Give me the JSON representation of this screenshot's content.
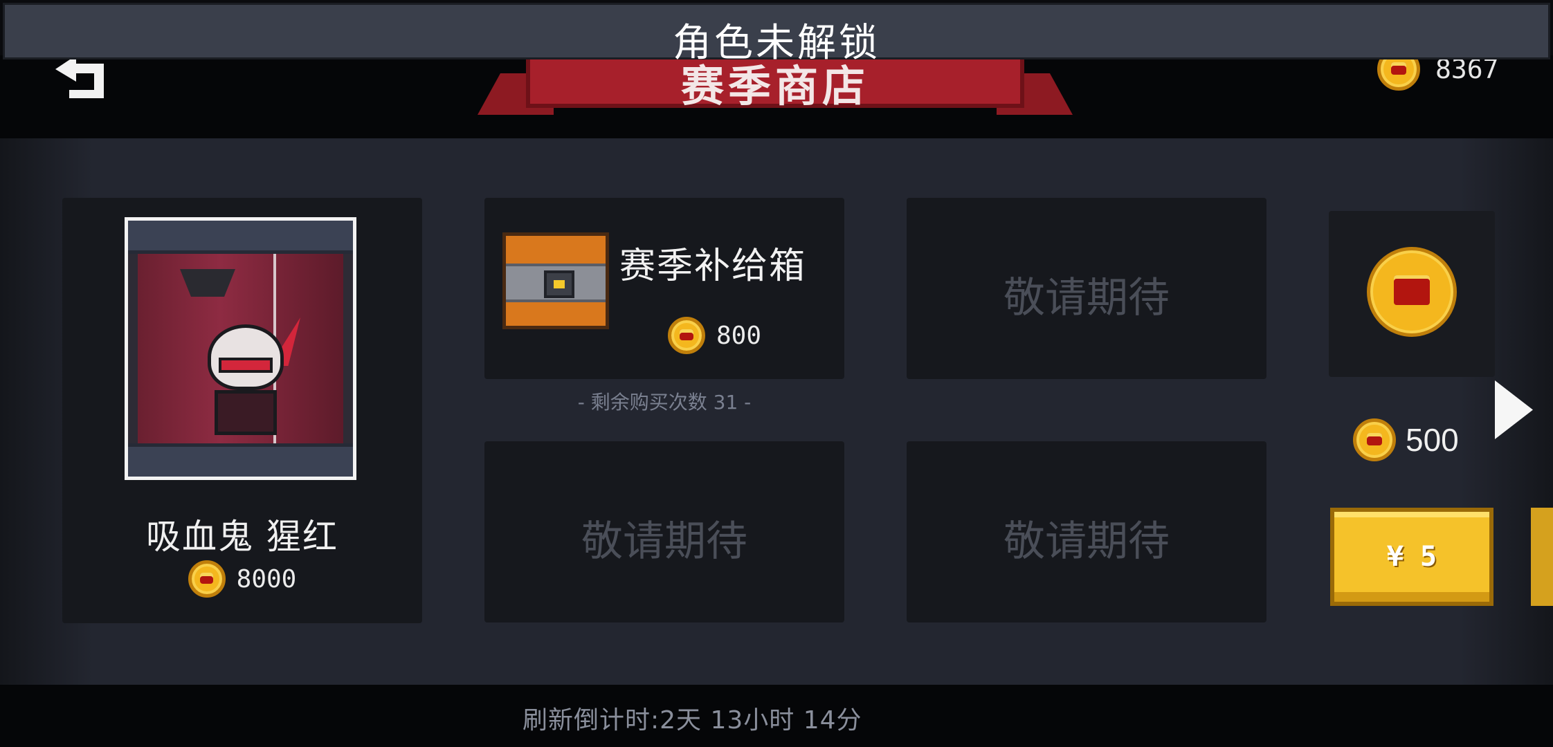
{
  "notice": {
    "text": "角色未解锁"
  },
  "header": {
    "title": "赛季商店",
    "currency_value": "8367"
  },
  "shop": {
    "character": {
      "name": "吸血鬼 猩红",
      "price": "8000"
    },
    "supply_box": {
      "title": "赛季补给箱",
      "price": "800",
      "remaining": "- 剩余购买次数 31 -"
    },
    "placeholders": [
      "敬请期待",
      "敬请期待",
      "敬请期待"
    ],
    "gold_pack": {
      "price": "500",
      "buy_label": "¥ 5"
    }
  },
  "footer": {
    "countdown": "刷新倒计时:2天 13小时 14分"
  },
  "icons": {
    "back": "back-arrow-icon",
    "coin": "coin-icon",
    "next": "chevron-right-icon",
    "chest": "treasure-chest-icon"
  },
  "colors": {
    "banner": "#a7202b",
    "coin": "#f4b71e",
    "buy_button": "#f5c22a",
    "panel": "#232630"
  }
}
